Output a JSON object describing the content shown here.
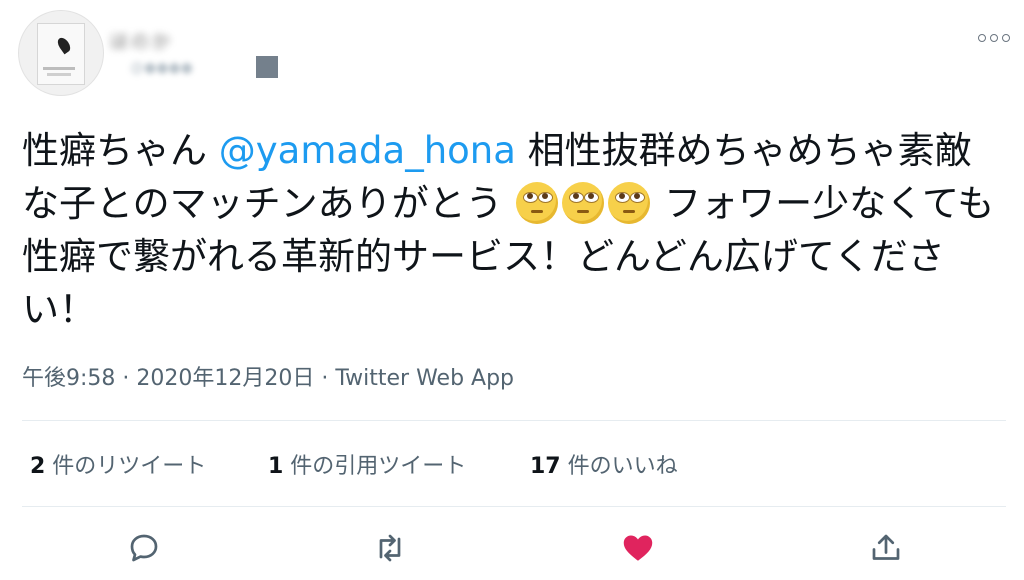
{
  "header": {
    "display_name": "ほのか",
    "handle": "@●●●●"
  },
  "tweet": {
    "text_before": "性癖ちゃん ",
    "mention": "@yamada_hona",
    "text_after": " 相性抜群めちゃめちゃ素敵な子とのマッチンありがとう",
    "emoji_name": "face-with-rolling-eyes",
    "emoji_count": 3,
    "text_end": " フォワー少なくても性癖で繋がれる革新的サービス！どんどん広げてください！"
  },
  "meta": {
    "time": "午後9:58",
    "sep1": " · ",
    "date": "2020年12月20日",
    "sep2": " · ",
    "source": "Twitter Web App"
  },
  "stats": {
    "retweets_count": "2",
    "retweets_label": " 件のリツイート",
    "quotes_count": "1",
    "quotes_label": " 件の引用ツイート",
    "likes_count": "17",
    "likes_label": " 件のいいね"
  },
  "actions": {
    "reply_icon": "reply-icon",
    "retweet_icon": "retweet-icon",
    "like_icon": "heart-icon",
    "share_icon": "share-icon",
    "like_color": "#e0245e",
    "icon_color": "#536471"
  },
  "colors": {
    "mention": "#1d9bf0",
    "text": "#0f1419",
    "muted": "#536471"
  }
}
